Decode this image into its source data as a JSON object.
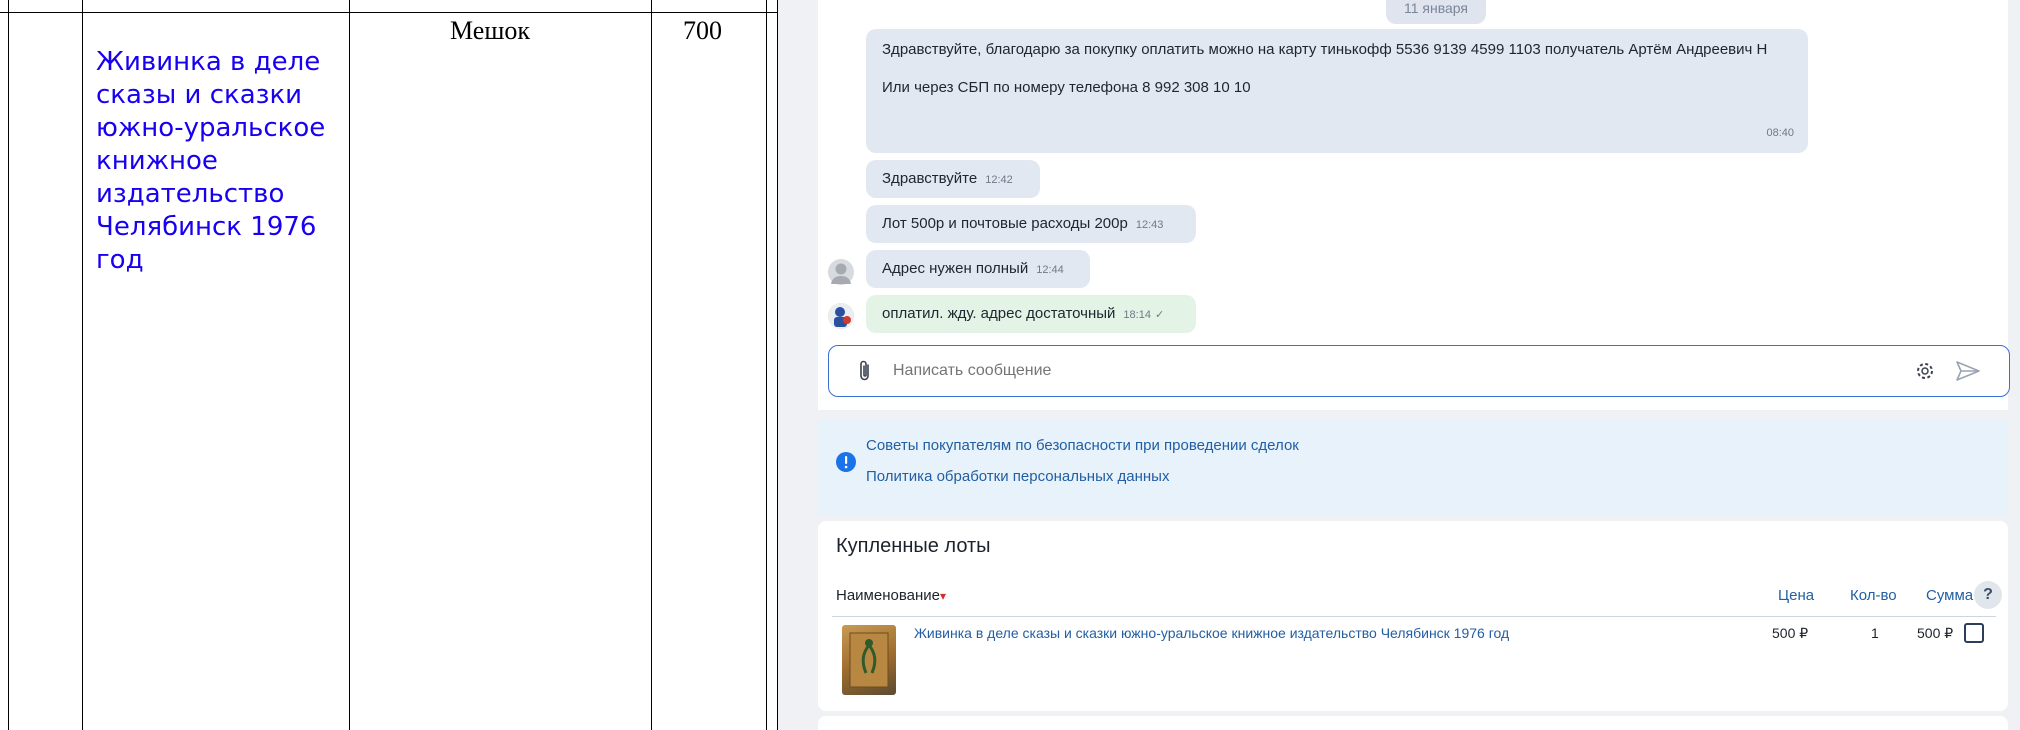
{
  "document_row": {
    "description": "Живинка в деле сказы и сказки южно-уральское книжное издательство Челябинск 1976 год",
    "package": "Мешок",
    "quantity": "700"
  },
  "chat": {
    "date_chip": "11 января",
    "messages": [
      {
        "text": "Здравствуйте, благодарю за покупку оплатить можно на карту  тинькофф 5536 9139 4599 1103 получатель Артём Андреевич Н",
        "text2": "Или через СБП по номеру телефона  8 992 308 10 10",
        "time": "08:40"
      },
      {
        "text": "Здравствуйте",
        "time": "12:42"
      },
      {
        "text": "Лот 500р и почтовые расходы 200р",
        "time": "12:43"
      },
      {
        "text": "Адрес нужен полный",
        "time": "12:44"
      },
      {
        "text": "оплатил. жду. адрес достаточный",
        "time": "18:14",
        "status": "✓"
      }
    ],
    "input": {
      "placeholder": "Написать сообщение"
    },
    "icons": {
      "attach": "paperclip-icon",
      "settings": "gear-icon",
      "send": "send-icon",
      "info": "exclamation-icon",
      "avatar_seller": "default-avatar-icon",
      "avatar_buyer": "user-avatar-icon"
    }
  },
  "tips": {
    "links": [
      "Советы покупателям по безопасности при проведении сделок",
      "Политика обработки персональных данных"
    ]
  },
  "bought_lots": {
    "title": "Купленные лоты",
    "columns": {
      "name": "Наименование",
      "sort_marker": "▾",
      "price": "Цена",
      "qty": "Кол-во",
      "sum": "Сумма",
      "help": "?"
    },
    "rows": [
      {
        "name": "Живинка в деле сказы и сказки южно-уральское книжное издательство Челябинск 1976 год",
        "price": "500 ₽",
        "qty": "1",
        "sum": "500 ₽"
      }
    ]
  },
  "colors": {
    "link": "#215ea3",
    "document_link": "#1800f0",
    "bubble": "#e1e8f1",
    "own_bubble": "#e3f3e6",
    "input_border": "#3b6ed1",
    "tips_bg": "#e8f2fb"
  }
}
